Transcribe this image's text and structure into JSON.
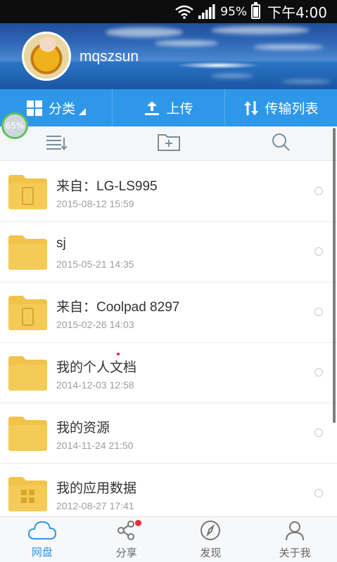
{
  "status_bar": {
    "battery_percent": "95%",
    "time": "下午4:00",
    "icons": [
      "wifi-icon",
      "signal-icon",
      "battery-icon"
    ]
  },
  "header": {
    "username": "mqszsun"
  },
  "topbar": {
    "category_label": "分类",
    "upload_label": "上传",
    "transfer_label": "传输列表"
  },
  "progress": {
    "text": "65%",
    "value": 0.65
  },
  "toolbar": {
    "icons": [
      "sort-list-icon",
      "new-folder-icon",
      "search-icon"
    ]
  },
  "files": [
    {
      "name": "来自：LG-LS995",
      "date": "2015-08-12  15:59",
      "folder_icon": "device-folder"
    },
    {
      "name": "sj",
      "date": "2015-05-21  14:35",
      "folder_icon": "plain-folder"
    },
    {
      "name": "来自：Coolpad 8297",
      "date": "2015-02-26  14:03",
      "folder_icon": "device-folder"
    },
    {
      "name": "我的个人文档",
      "date": "2014-12-03  12:58",
      "folder_icon": "plain-folder"
    },
    {
      "name": "我的资源",
      "date": "2014-11-24  21:50",
      "folder_icon": "plain-folder"
    },
    {
      "name": "我的应用数据",
      "date": "2012-08-27  17:41",
      "folder_icon": "apps-folder"
    }
  ],
  "bottom_nav": {
    "items": [
      {
        "label": "网盘",
        "icon": "cloud-icon",
        "active": true
      },
      {
        "label": "分享",
        "icon": "share-icon",
        "active": false
      },
      {
        "label": "发现",
        "icon": "compass-icon",
        "active": false
      },
      {
        "label": "关于我",
        "icon": "person-icon",
        "active": false
      }
    ]
  },
  "colors": {
    "accent": "#2f97e8",
    "folder": "#f2c34a",
    "notification": "#e5303d"
  }
}
